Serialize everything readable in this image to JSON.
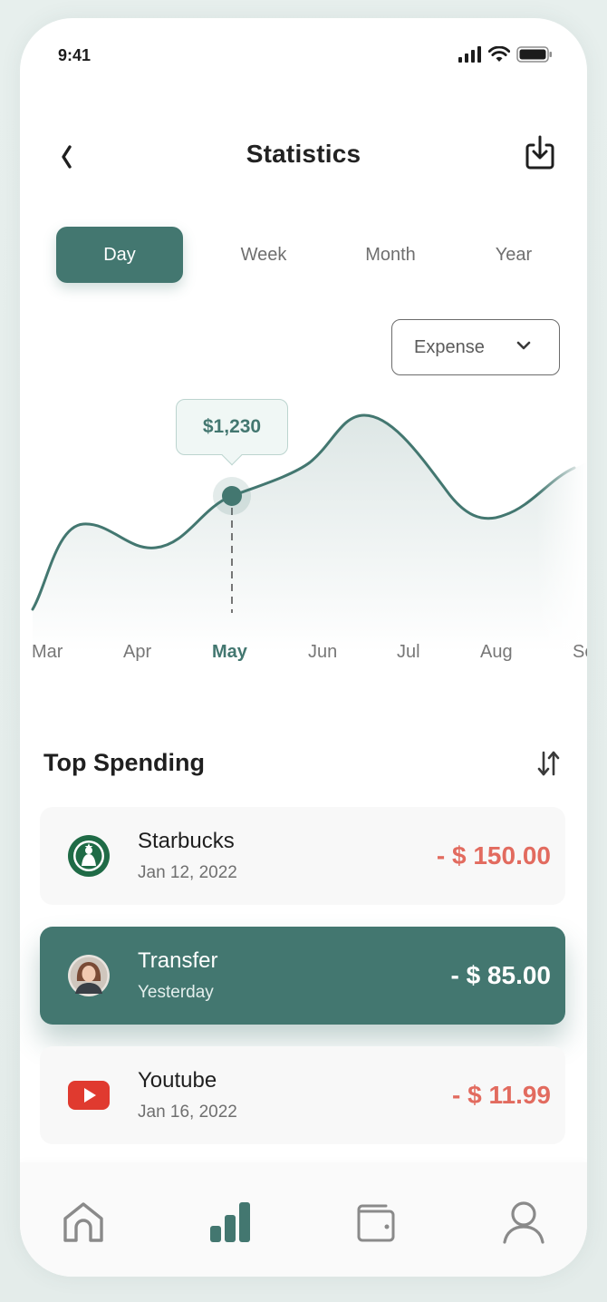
{
  "status_bar": {
    "time": "9:41"
  },
  "header": {
    "title": "Statistics"
  },
  "period_tabs": [
    {
      "label": "Day",
      "active": true
    },
    {
      "label": "Week",
      "active": false
    },
    {
      "label": "Month",
      "active": false
    },
    {
      "label": "Year",
      "active": false
    }
  ],
  "type_select": {
    "value": "Expense"
  },
  "chart_data": {
    "type": "area",
    "x": [
      "Mar",
      "Apr",
      "May",
      "Jun",
      "Jul",
      "Aug",
      "Se"
    ],
    "highlight": {
      "x": "May",
      "label": "$1,230"
    },
    "color": "#437770"
  },
  "section": {
    "title": "Top Spending"
  },
  "transactions": [
    {
      "name": "Starbucks",
      "date": "Jan 12, 2022",
      "amount": "- $ 150.00",
      "icon": "starbucks-logo",
      "highlight": false
    },
    {
      "name": "Transfer",
      "date": "Yesterday",
      "amount": "- $ 85.00",
      "icon": "avatar",
      "highlight": true
    },
    {
      "name": "Youtube",
      "date": "Jan 16, 2022",
      "amount": "- $ 11.99",
      "icon": "youtube-logo",
      "highlight": false
    }
  ],
  "nav": [
    {
      "icon": "home-icon",
      "active": false
    },
    {
      "icon": "chart-icon",
      "active": true
    },
    {
      "icon": "wallet-icon",
      "active": false
    },
    {
      "icon": "user-icon",
      "active": false
    }
  ],
  "colors": {
    "accent": "#437770",
    "negative": "#e26b5f"
  }
}
